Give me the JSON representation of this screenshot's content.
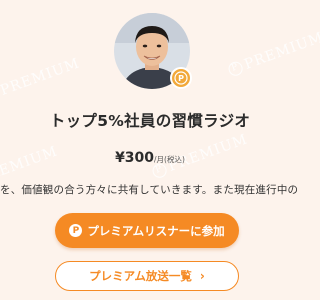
{
  "watermark": {
    "text": "PREMIUM",
    "badge": "P"
  },
  "profile": {
    "badge_letter": "P"
  },
  "program": {
    "title": "トップ5%社員の習慣ラジオ"
  },
  "pricing": {
    "amount": "¥300",
    "unit": "/月(税込)"
  },
  "description": "を、価値観の合う方々に共有していきます。また現在進行中の「働き",
  "actions": {
    "join_icon": "P",
    "join_label": "プレミアムリスナーに参加",
    "episodes_label": "プレミアム放送一覧",
    "episodes_chevron": "›"
  },
  "colors": {
    "accent": "#f58a24",
    "background": "#fdf3ec"
  },
  "icons": [
    "premium-badge-icon",
    "chevron-right-icon"
  ]
}
